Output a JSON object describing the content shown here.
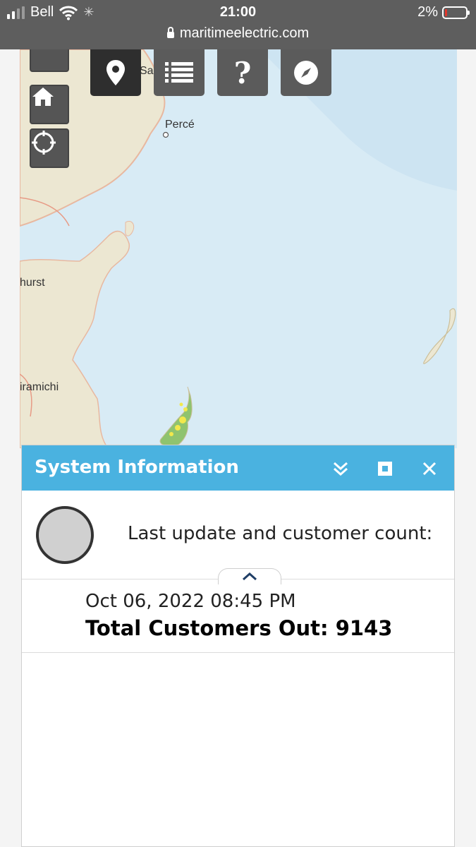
{
  "status_bar": {
    "carrier": "Bell",
    "time": "21:00",
    "battery": "2%",
    "url": "maritimeelectric.com"
  },
  "map": {
    "labels": {
      "perce": "Percé",
      "sa": "Sa",
      "bathurst": "hurst",
      "miramichi": "iramichi"
    },
    "toolbar": [
      "map-marker-icon",
      "list-icon",
      "help-icon",
      "compass-icon"
    ]
  },
  "panel": {
    "title": "System Information",
    "status_label": "Last update and customer count:",
    "last_update": "Oct 06, 2022 08:45 PM",
    "total_customers_out": "Total Customers Out: 9143",
    "header_color": "#4ab2e0"
  }
}
